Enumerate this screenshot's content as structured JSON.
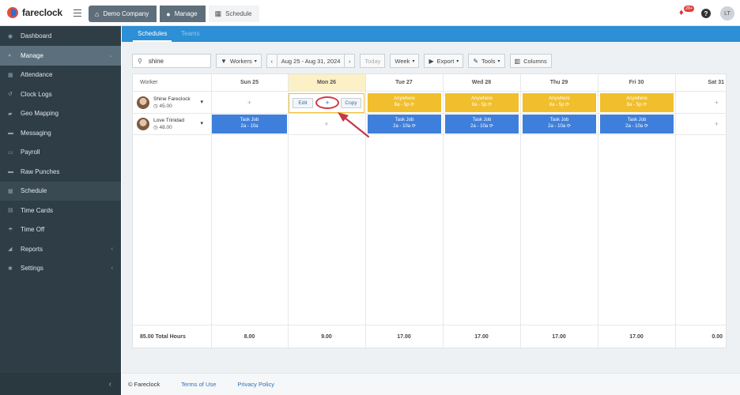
{
  "app": {
    "name": "fareclock"
  },
  "breadcrumbs": [
    "Demo Company",
    "Manage",
    "Schedule"
  ],
  "header": {
    "notification_count": "28+",
    "help": "?",
    "avatar_initials": "LT"
  },
  "sidebar": {
    "items": [
      {
        "label": "Dashboard",
        "icon": "dashboard-icon"
      },
      {
        "label": "Manage",
        "icon": "user-icon"
      },
      {
        "label": "Attendance",
        "icon": "calendar-icon"
      },
      {
        "label": "Clock Logs",
        "icon": "history-icon"
      },
      {
        "label": "Geo Mapping",
        "icon": "map-icon"
      },
      {
        "label": "Messaging",
        "icon": "message-icon"
      },
      {
        "label": "Payroll",
        "icon": "money-icon"
      },
      {
        "label": "Raw Punches",
        "icon": "truck-icon"
      },
      {
        "label": "Schedule",
        "icon": "grid-icon"
      },
      {
        "label": "Time Cards",
        "icon": "card-icon"
      },
      {
        "label": "Time Off",
        "icon": "umbrella-icon"
      },
      {
        "label": "Reports",
        "icon": "chart-icon"
      },
      {
        "label": "Settings",
        "icon": "gear-icon"
      }
    ],
    "collapse": "‹"
  },
  "tabs": [
    "Schedules",
    "Teams"
  ],
  "toolbar": {
    "search_value": "shine",
    "workers": "Workers",
    "date_range": "Aug 25 - Aug 31, 2024",
    "today": "Today",
    "view": "Week",
    "export": "Export",
    "tools": "Tools",
    "columns": "Columns"
  },
  "grid": {
    "worker_header": "Worker",
    "days": [
      "Sun 25",
      "Mon 26",
      "Tue 27",
      "Wed 28",
      "Thu 29",
      "Fri 30",
      "Sat 31"
    ],
    "workers": [
      {
        "name": "Shine Fareclock",
        "hours": "45.00"
      },
      {
        "name": "Love Trinidad",
        "hours": "48.00"
      }
    ],
    "shift_yellow": {
      "title": "Anywhere",
      "time": "8a - 5p"
    },
    "shift_blue": {
      "title": "Task Job",
      "time": "2a - 10a"
    },
    "edit": "Edit",
    "plus": "+",
    "copy": "Copy",
    "totals_label": "85.00 Total Hours",
    "totals": [
      "8.00",
      "9.00",
      "17.00",
      "17.00",
      "17.00",
      "17.00",
      "0.00"
    ]
  },
  "footer": {
    "copyright": "© Fareclock",
    "terms": "Terms of Use",
    "privacy": "Privacy Policy"
  }
}
